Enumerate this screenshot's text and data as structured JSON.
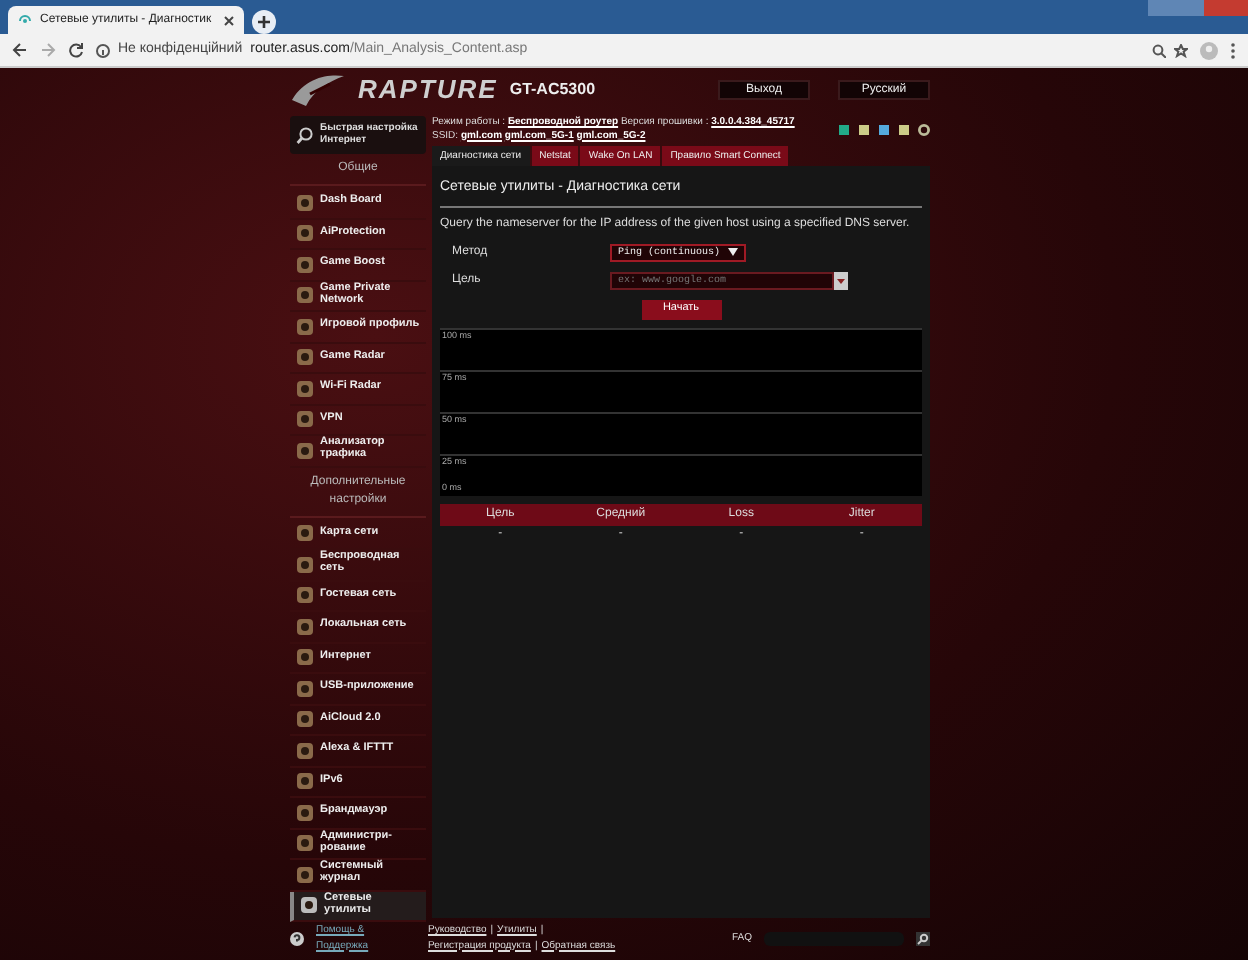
{
  "browser": {
    "tab_title": "Сетевые утилиты - Диагностик",
    "security": "Не конфіденційний",
    "url_host": "router.asus.com",
    "url_path": "/Main_Analysis_Content.asp"
  },
  "header": {
    "brand": "RAPTURE",
    "model": "GT-AC5300",
    "logout": "Выход",
    "language": "Русский"
  },
  "info": {
    "mode_label": "Режим работы :",
    "mode_value": "Беспроводной роутер",
    "fw_label": "Версия прошивки :",
    "fw_value": "3.0.0.4.384_45717",
    "ssid_label": "SSID:",
    "ssids": [
      "gml.com",
      "gml.com_5G-1",
      "gml.com_5G-2"
    ]
  },
  "sidebar": {
    "quick_setup": "Быстрая настройка Интернет",
    "sections": [
      {
        "title": "Общие",
        "items": [
          {
            "label": "Dash Board",
            "selected": false
          },
          {
            "label": "AiProtection",
            "selected": false
          },
          {
            "label": "Game Boost",
            "selected": false
          },
          {
            "label": "Game Private Network",
            "selected": false
          },
          {
            "label": "Игровой профиль",
            "selected": false
          },
          {
            "label": "Game Radar",
            "selected": false
          },
          {
            "label": "Wi-Fi Radar",
            "selected": false
          },
          {
            "label": "VPN",
            "selected": false
          },
          {
            "label": "Анализатор трафика",
            "selected": false
          }
        ]
      },
      {
        "title": "Дополнительные настройки",
        "items": [
          {
            "label": "Карта сети",
            "selected": false
          },
          {
            "label": "Беспроводная сеть",
            "selected": false
          },
          {
            "label": "Гостевая сеть",
            "selected": false
          },
          {
            "label": "Локальная сеть",
            "selected": false
          },
          {
            "label": "Интернет",
            "selected": false
          },
          {
            "label": "USB-приложение",
            "selected": false
          },
          {
            "label": "AiCloud 2.0",
            "selected": false
          },
          {
            "label": "Alexa & IFTTT",
            "selected": false
          },
          {
            "label": "IPv6",
            "selected": false
          },
          {
            "label": "Брандмауэр",
            "selected": false
          },
          {
            "label": "Администри-рование",
            "selected": false
          },
          {
            "label": "Системный журнал",
            "selected": false
          },
          {
            "label": "Сетевые утилиты",
            "selected": true
          }
        ]
      }
    ]
  },
  "tabs": [
    {
      "label": "Диагностика сети",
      "selected": true
    },
    {
      "label": "Netstat",
      "selected": false
    },
    {
      "label": "Wake On LAN",
      "selected": false
    },
    {
      "label": "Правило Smart Connect",
      "selected": false
    }
  ],
  "panel": {
    "title": "Сетевые утилиты - Диагностика сети",
    "description": "Query the nameserver for the IP address of the given host using a specified DNS server.",
    "fields": [
      {
        "kind": "select",
        "label": "Метод",
        "value": "Ping (continuous)"
      },
      {
        "kind": "text",
        "label": "Цель",
        "placeholder": "ex: www.google.com"
      }
    ],
    "start_button": "Начать",
    "graph": {
      "y_labels": [
        "100 ms",
        "75 ms",
        "50 ms",
        "25 ms",
        "0 ms"
      ]
    },
    "table": {
      "columns": [
        "Цель",
        "Средний",
        "Loss",
        "Jitter"
      ],
      "rows": [
        [
          "-",
          "-",
          "-",
          "-"
        ]
      ]
    }
  },
  "footer": {
    "help": "Помощь & Поддержка",
    "links": [
      "Руководство",
      "Утилиты",
      "Регистрация продукта",
      "Обратная связь"
    ],
    "separator": "|",
    "faq": "FAQ"
  }
}
